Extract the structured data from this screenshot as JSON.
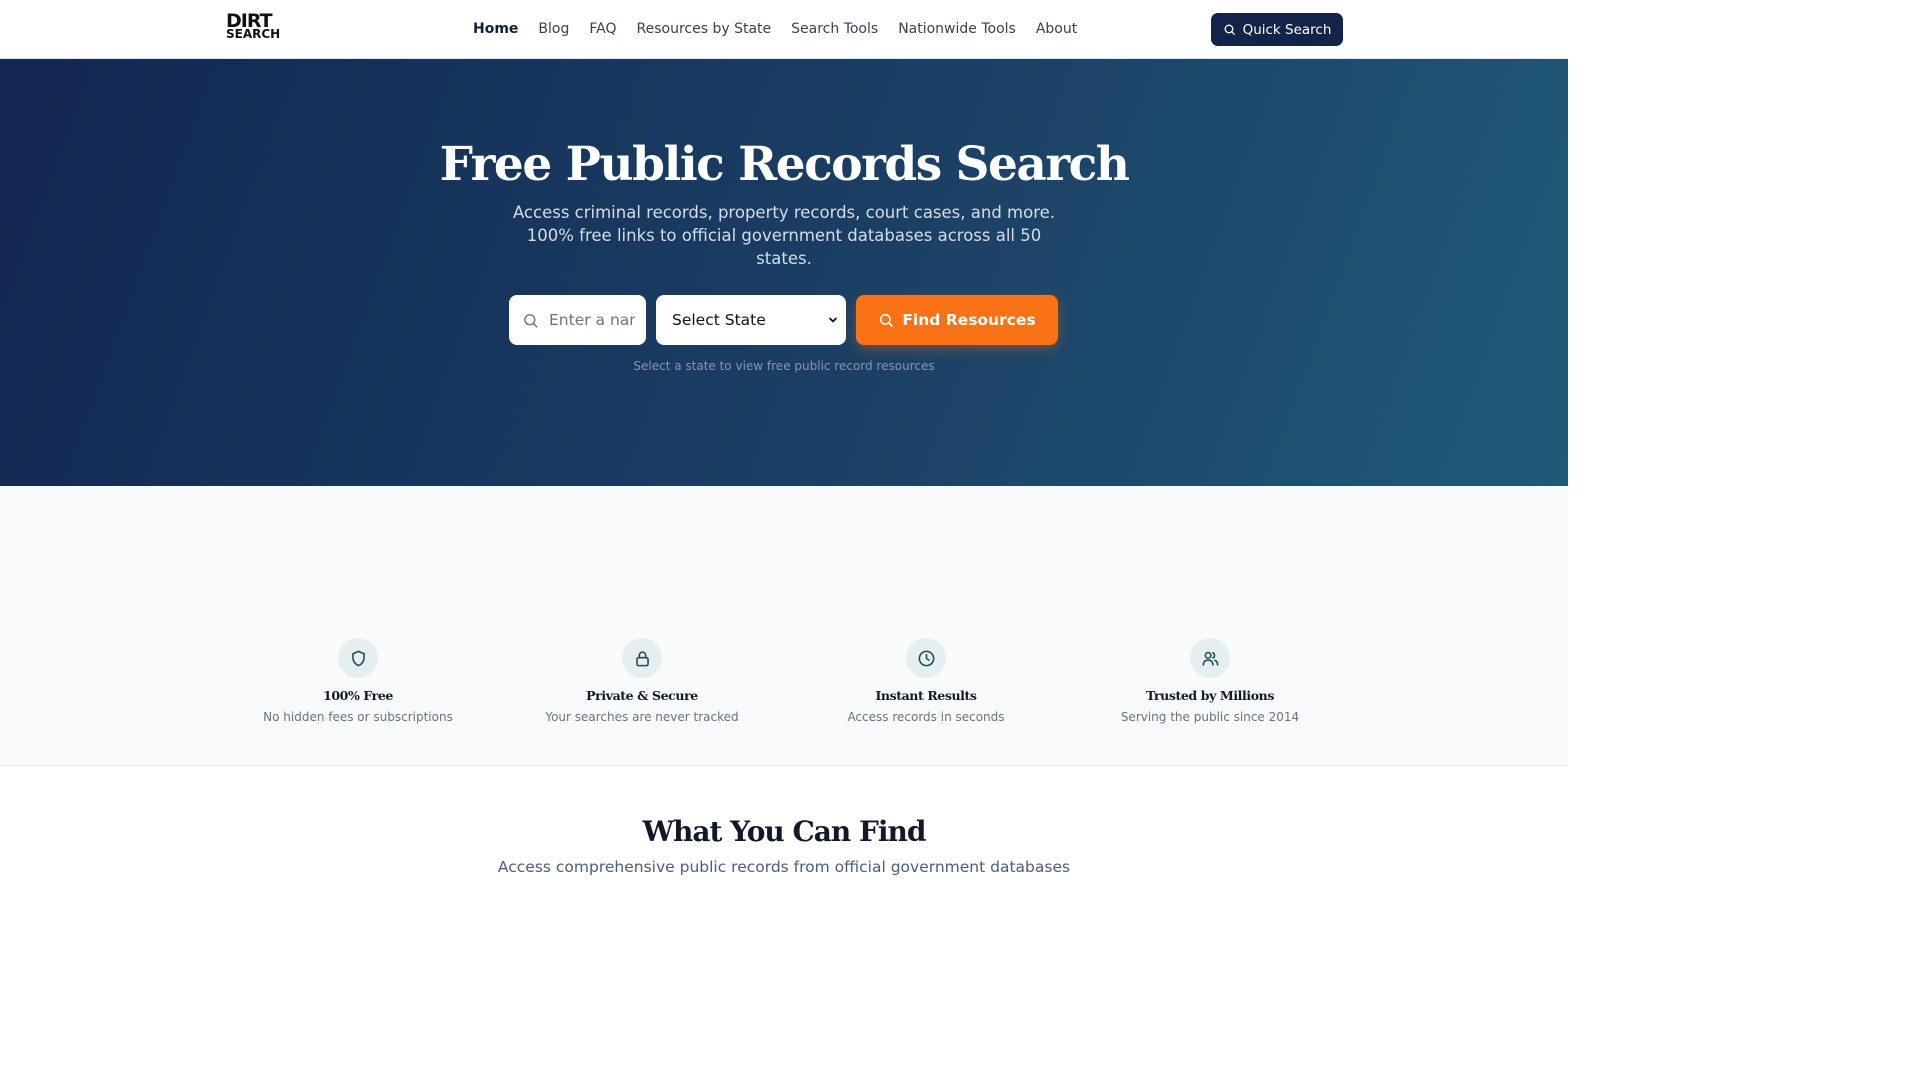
{
  "header": {
    "logo_line1": "DIRT",
    "logo_line2": "SEARCH",
    "nav": [
      {
        "label": "Home",
        "active": true
      },
      {
        "label": "Blog"
      },
      {
        "label": "FAQ"
      },
      {
        "label": "Resources by State"
      },
      {
        "label": "Search Tools"
      },
      {
        "label": "Nationwide Tools"
      },
      {
        "label": "About"
      }
    ],
    "quick_search_label": "Quick Search"
  },
  "hero": {
    "title": "Free Public Records Search",
    "subtitle": "Access criminal records, property records, court cases, and more. 100% free links to official government databases across all 50 states.",
    "name_placeholder": "Enter a name",
    "state_select_value": "Select State",
    "find_button_label": "Find Resources",
    "hint": "Select a state to view free public record resources"
  },
  "features": [
    {
      "icon": "shield-icon",
      "title": "100% Free",
      "desc": "No hidden fees or subscriptions"
    },
    {
      "icon": "lock-icon",
      "title": "Private & Secure",
      "desc": "Your searches are never tracked"
    },
    {
      "icon": "clock-icon",
      "title": "Instant Results",
      "desc": "Access records in seconds"
    },
    {
      "icon": "users-icon",
      "title": "Trusted by Millions",
      "desc": "Serving the public since 2014"
    }
  ],
  "find_section": {
    "title": "What You Can Find",
    "subtitle": "Access comprehensive public records from official government databases"
  },
  "colors": {
    "brand_navy": "#14234a",
    "accent_orange": "#f97316",
    "icon_teal": "#1f4e5a"
  }
}
